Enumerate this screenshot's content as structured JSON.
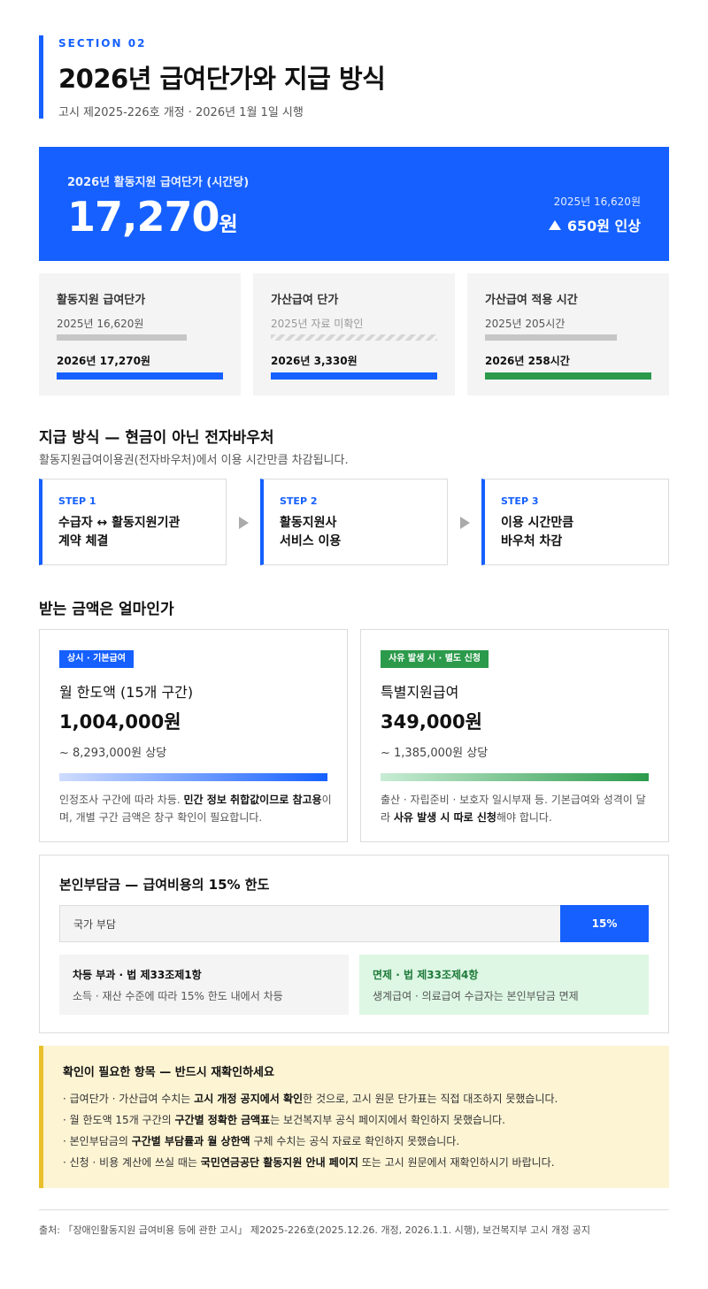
{
  "header": {
    "section": "SECTION 02",
    "title": "2026년 급여단가와 지급 방식",
    "subtitle": "고시 제2025-226호 개정 · 2026년 1월 1일 시행"
  },
  "hero": {
    "label": "2026년 활동지원 급여단가 (시간당)",
    "amount": "17,270",
    "unit": "원",
    "prev": "2025년 16,620원",
    "increase": "650원 인상"
  },
  "comparisons": [
    {
      "title": "활동지원 급여단가",
      "prev_label": "2025년  16,620원",
      "prev_ratio": 0.782,
      "cur_label": "2026년  17,270원",
      "cur_ratio": 1.0,
      "color": "#1560ff",
      "prev_known": true
    },
    {
      "title": "가산급여 단가",
      "prev_label": "2025년  자료 미확인",
      "prev_ratio": null,
      "cur_label": "2026년  3,330원",
      "cur_ratio": 1.0,
      "color": "#1560ff",
      "prev_known": false
    },
    {
      "title": "가산급여 적용 시간",
      "prev_label": "2025년  205시간",
      "prev_ratio": 0.794,
      "cur_label": "2026년  258시간",
      "cur_ratio": 1.0,
      "color": "#2b9a4b",
      "prev_known": true
    }
  ],
  "payment": {
    "title": "지급 방식 — 현금이 아닌 전자바우처",
    "desc": "활동지원급여이용권(전자바우처)에서 이용 시간만큼 차감됩니다.",
    "steps": [
      {
        "no": "STEP 1",
        "line1": "수급자 ↔ 활동지원기관",
        "line2": "계약 체결"
      },
      {
        "no": "STEP 2",
        "line1": "활동지원사",
        "line2": "서비스 이용"
      },
      {
        "no": "STEP 3",
        "line1": "이용 시간만큼",
        "line2": "바우처 차감"
      }
    ]
  },
  "amounts": {
    "title": "받는 금액은 얼마인가",
    "basic": {
      "tag": "상시 · 기본급여",
      "title": "월 한도액 (15개 구간)",
      "amount": "1,004,000원",
      "eq": "~ 8,293,000원 상당",
      "note_a": "인정조사 구간에 따라 차등. ",
      "note_b": "민간 정보 취합값이므로 참고용",
      "note_c": "이며, 개별 구간 금액은 창구 확인이 필요합니다."
    },
    "special": {
      "tag": "사유 발생 시 · 별도 신청",
      "title": "특별지원급여",
      "amount": "349,000원",
      "eq": "~ 1,385,000원 상당",
      "note_a": "출산 · 자립준비 · 보호자 일시부재 등. 기본급여와 성격이 달라 ",
      "note_b": "사유 발생 시 따로 신청",
      "note_c": "해야 합니다."
    }
  },
  "copay": {
    "title": "본인부담금 — 급여비용의 15% 한도",
    "state_label": "국가 부담",
    "self_label": "15%",
    "self_ratio": 0.15,
    "left": {
      "title": "차등 부과 · 법 제33조제1항",
      "text": "소득 · 재산 수준에 따라 15% 한도 내에서 차등"
    },
    "right": {
      "title": "면제 · 법 제33조제4항",
      "text": "생계급여 · 의료급여 수급자는 본인부담금 면제"
    }
  },
  "notice": {
    "title": "확인이 필요한 항목 — 반드시 재확인하세요",
    "items": [
      {
        "a": "· 급여단가 · 가산급여 수치는 ",
        "b": "고시 개정 공지에서 확인",
        "c": "한 것으로, 고시 원문 단가표는 직접 대조하지 못했습니다."
      },
      {
        "a": "· 월 한도액 15개 구간의 ",
        "b": "구간별 정확한 금액표",
        "c": "는 보건복지부 공식 페이지에서 확인하지 못했습니다."
      },
      {
        "a": "· 본인부담금의 ",
        "b": "구간별 부담률과 월 상한액",
        "c": " 구체 수치는 공식 자료로 확인하지 못했습니다."
      },
      {
        "a": "· 신청 · 비용 계산에 쓰실 때는 ",
        "b": "국민연금공단 활동지원 안내 페이지",
        "c": " 또는 고시 원문에서 재확인하시기 바랍니다."
      }
    ]
  },
  "source": "출처: 「장애인활동지원 급여비용 등에 관한 고시」 제2025-226호(2025.12.26. 개정, 2026.1.1. 시행), 보건복지부 고시 개정 공지"
}
